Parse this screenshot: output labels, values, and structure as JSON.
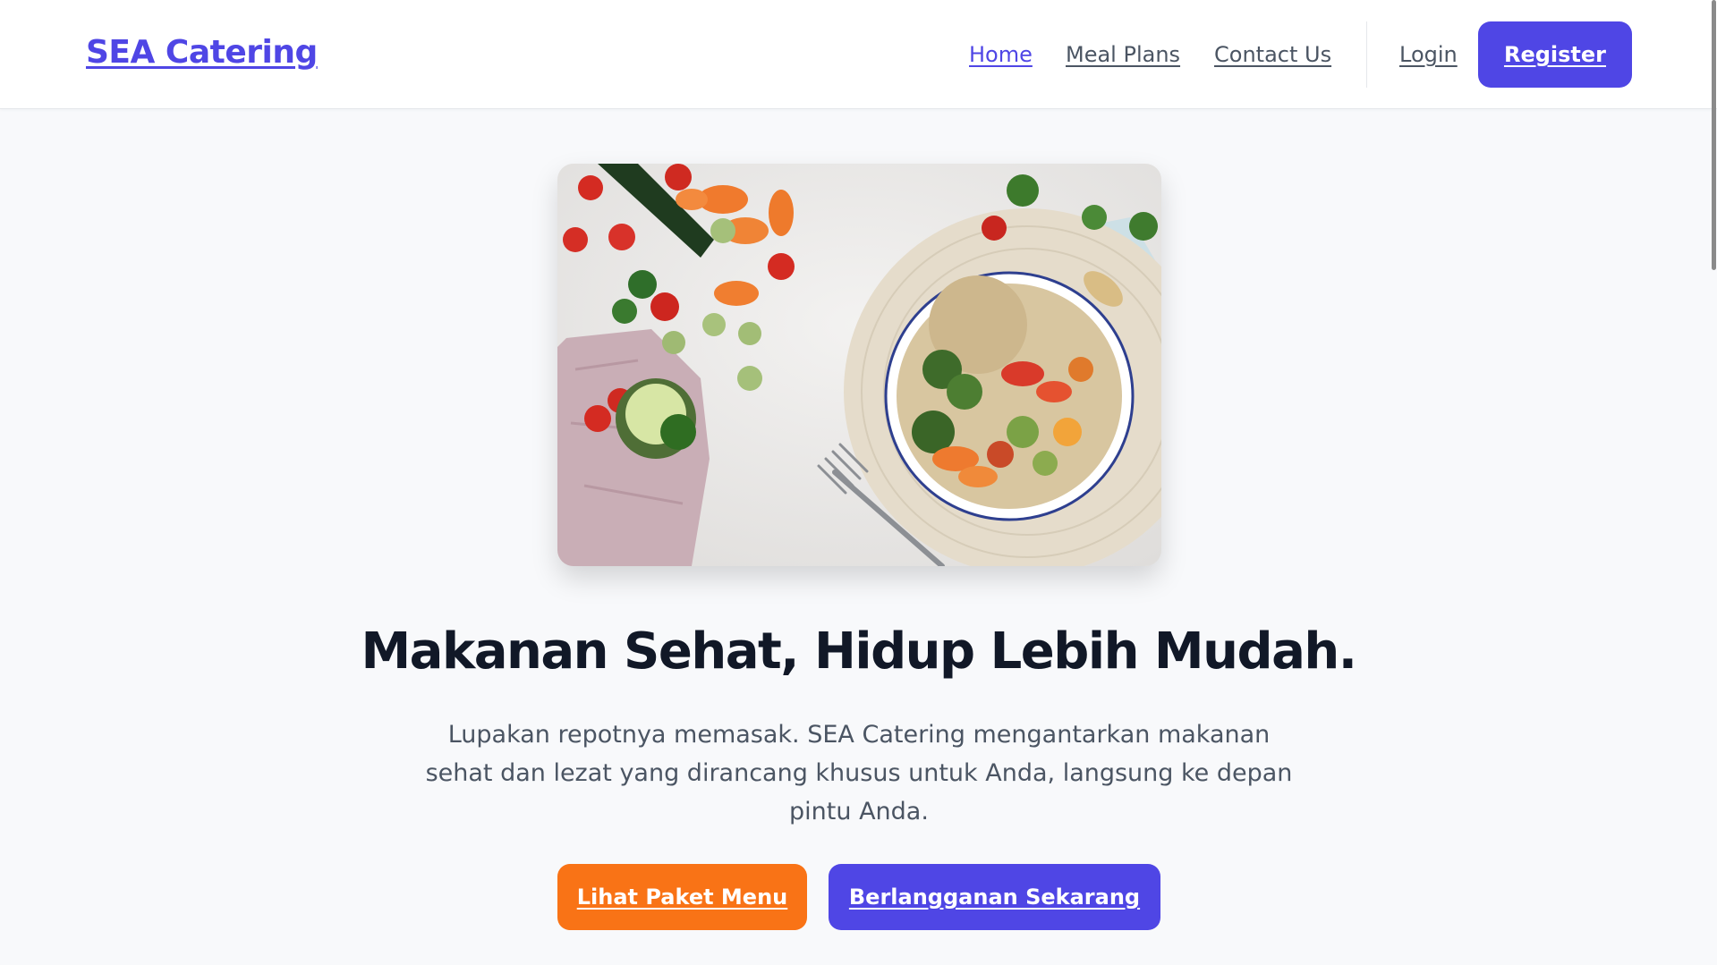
{
  "nav": {
    "brand": "SEA Catering",
    "links": [
      {
        "label": "Home",
        "active": true
      },
      {
        "label": "Meal Plans",
        "active": false
      },
      {
        "label": "Contact Us",
        "active": false
      }
    ],
    "login_label": "Login",
    "register_label": "Register"
  },
  "hero": {
    "title": "Makanan Sehat, Hidup Lebih Mudah.",
    "description": "Lupakan repotnya memasak. SEA Catering mengantarkan makanan sehat dan lezat yang dirancang khusus untuk Anda, langsung ke depan pintu Anda.",
    "primary_cta": "Lihat Paket Menu",
    "secondary_cta": "Berlangganan Sekarang"
  },
  "colors": {
    "accent": "#4f46e5",
    "cta_orange": "#f97316",
    "background": "#f8f9fb"
  }
}
